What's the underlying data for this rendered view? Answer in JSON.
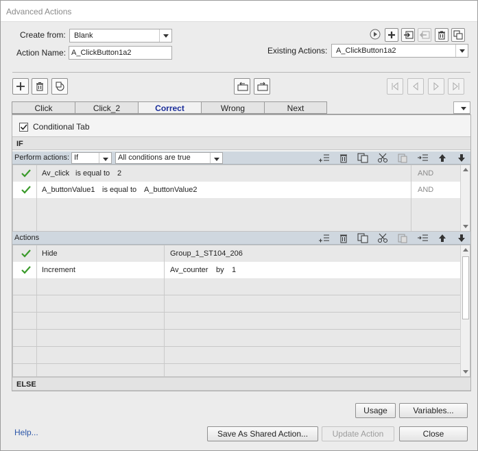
{
  "window": {
    "title": "Advanced Actions"
  },
  "header": {
    "create_from_label": "Create from:",
    "create_from_value": "Blank",
    "action_name_label": "Action Name:",
    "action_name_value": "A_ClickButton1a2",
    "existing_actions_label": "Existing Actions:",
    "existing_actions_value": "A_ClickButton1a2",
    "icons": [
      "preview-icon",
      "new-action-icon",
      "import-icon",
      "export-icon",
      "delete-action-icon",
      "duplicate-action-icon"
    ]
  },
  "decision_toolbar": {
    "icons": [
      "add-decision-icon",
      "delete-decision-icon",
      "duplicate-decision-icon",
      "move-left-icon",
      "move-right-icon",
      "first-icon",
      "previous-icon",
      "next-icon",
      "last-icon"
    ]
  },
  "tabs": [
    {
      "label": "Click"
    },
    {
      "label": "Click_2"
    },
    {
      "label": "Correct",
      "active": true
    },
    {
      "label": "Wrong"
    },
    {
      "label": "Next"
    }
  ],
  "conditional_tab": {
    "label": "Conditional Tab",
    "checked": true
  },
  "if_section": {
    "label": "IF",
    "perform_actions_label": "Perform actions:",
    "perform_actions_value": "If",
    "conditions_value": "All conditions are true",
    "rows": [
      {
        "var": "Av_click",
        "op": "is equal to",
        "value": "2",
        "join": "AND"
      },
      {
        "var": "A_buttonValue1",
        "op": "is equal to",
        "value": "A_buttonValue2",
        "join": "AND"
      }
    ]
  },
  "actions_section": {
    "label": "Actions",
    "rows": [
      {
        "action": "Hide",
        "target": "Group_1_ST104_206"
      },
      {
        "action": "Increment",
        "target": "Av_counter",
        "by_label": "by",
        "amount": "1"
      }
    ]
  },
  "else_section": {
    "label": "ELSE"
  },
  "footer": {
    "help_label": "Help...",
    "usage_label": "Usage",
    "variables_label": "Variables...",
    "save_shared_label": "Save As Shared Action...",
    "update_label": "Update Action",
    "close_label": "Close"
  },
  "colors": {
    "accent_tab": "#1a2d9a",
    "check_green": "#3a9a2a",
    "toolbar_blue": "#cfd7df"
  }
}
